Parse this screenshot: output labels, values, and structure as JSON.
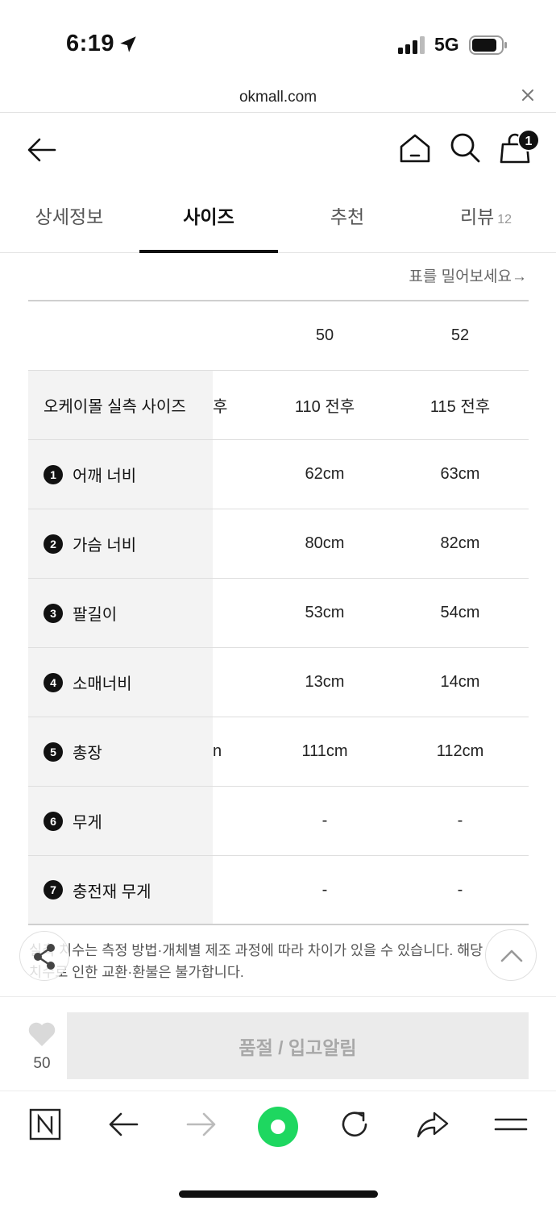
{
  "status_bar": {
    "time": "6:19",
    "network": "5G"
  },
  "url_bar": {
    "url": "okmall.com"
  },
  "header": {
    "cart_count": "1"
  },
  "tabs": [
    {
      "label": "상세정보",
      "active": false
    },
    {
      "label": "사이즈",
      "active": true
    },
    {
      "label": "추천",
      "active": false
    },
    {
      "label": "리뷰",
      "count": "12",
      "active": false
    }
  ],
  "size_chart": {
    "scroll_hint": "표를 밀어보세요→",
    "columns": [
      "50",
      "52"
    ],
    "rows": [
      {
        "label": "오케이몰 실측 사이즈",
        "number": "",
        "peek": "후",
        "values": [
          "110 전후",
          "115 전후"
        ]
      },
      {
        "label": "어깨 너비",
        "number": "1",
        "peek": "",
        "values": [
          "62cm",
          "63cm"
        ]
      },
      {
        "label": "가슴 너비",
        "number": "2",
        "peek": "",
        "values": [
          "80cm",
          "82cm"
        ]
      },
      {
        "label": "팔길이",
        "number": "3",
        "peek": "",
        "values": [
          "53cm",
          "54cm"
        ]
      },
      {
        "label": "소매너비",
        "number": "4",
        "peek": "",
        "values": [
          "13cm",
          "14cm"
        ]
      },
      {
        "label": "총장",
        "number": "5",
        "peek": "n",
        "values": [
          "111cm",
          "112cm"
        ]
      },
      {
        "label": "무게",
        "number": "6",
        "peek": "",
        "values": [
          "-",
          "-"
        ]
      },
      {
        "label": "충전재 무게",
        "number": "7",
        "peek": "",
        "values": [
          "-",
          "-"
        ]
      }
    ]
  },
  "notice": {
    "line1": "실측 치수는 측정 방법·개체별 제조 과정에 따라 차이가 있을 수 있습니다. 해당",
    "line2": "치수로 인한 교환·환불은 불가합니다."
  },
  "purchase_bar": {
    "like_count": "50",
    "button_label": "품절 / 입고알림"
  },
  "colors": {
    "accent_green": "#1ed760",
    "primary": "#111111",
    "disabled_bg": "#ebebeb"
  }
}
